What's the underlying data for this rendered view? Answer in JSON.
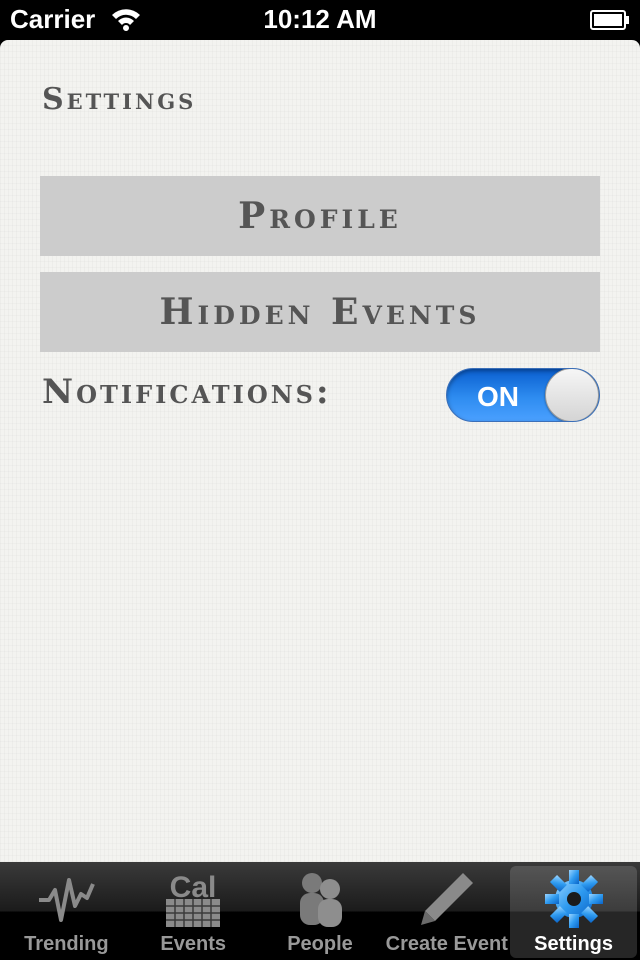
{
  "status_bar": {
    "carrier": "Carrier",
    "time": "10:12 AM",
    "wifi_icon": "wifi-icon",
    "battery_icon": "battery-icon"
  },
  "page": {
    "title": "Settings"
  },
  "menu": {
    "profile_label": "Profile",
    "hidden_events_label": "Hidden Events"
  },
  "notifications": {
    "label": "Notifications:",
    "toggle_text": "ON",
    "enabled": true,
    "accent_color": "#1f7ae6"
  },
  "tab_bar": {
    "tabs": [
      {
        "label": "Trending",
        "icon": "trending-icon",
        "active": false
      },
      {
        "label": "Events",
        "icon": "calendar-icon",
        "icon_text": "Cal",
        "active": false
      },
      {
        "label": "People",
        "icon": "people-icon",
        "active": false
      },
      {
        "label": "Create Event",
        "icon": "pencil-icon",
        "active": false
      },
      {
        "label": "Settings",
        "icon": "gear-icon",
        "active": true
      }
    ]
  }
}
